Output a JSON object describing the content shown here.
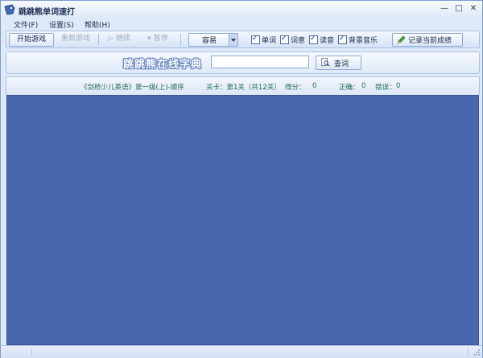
{
  "window": {
    "title": "跳跳熊单词速打",
    "controls": {
      "minimize": "—",
      "maximize": "□",
      "close": "✕"
    }
  },
  "menu": [
    {
      "label": "文件(F)"
    },
    {
      "label": "设置(S)"
    },
    {
      "label": "帮助(H)"
    }
  ],
  "toolbar": {
    "start": "开始游戏",
    "restart": "重新游戏",
    "continue": "继续",
    "pause": "暂停",
    "difficulty": "容易",
    "options": [
      {
        "label": "单词",
        "checked": true
      },
      {
        "label": "词意",
        "checked": true
      },
      {
        "label": "读音",
        "checked": true
      },
      {
        "label": "背景音乐",
        "checked": true
      }
    ],
    "record": "记录当前成绩"
  },
  "dictionary": {
    "title": "跳跳熊在线字典",
    "input_value": "",
    "query": "查词"
  },
  "status": {
    "book": "《剑桥少儿英语》第一级(上)-顺序",
    "level": "关卡：第1关（共12关）",
    "score_label": "得分：",
    "score": "0",
    "correct_label": "正确：",
    "correct": "0",
    "wrong_label": "错误：",
    "wrong": "0"
  },
  "colors": {
    "game_area": "#4867ad",
    "accent": "#7e9dcf"
  }
}
